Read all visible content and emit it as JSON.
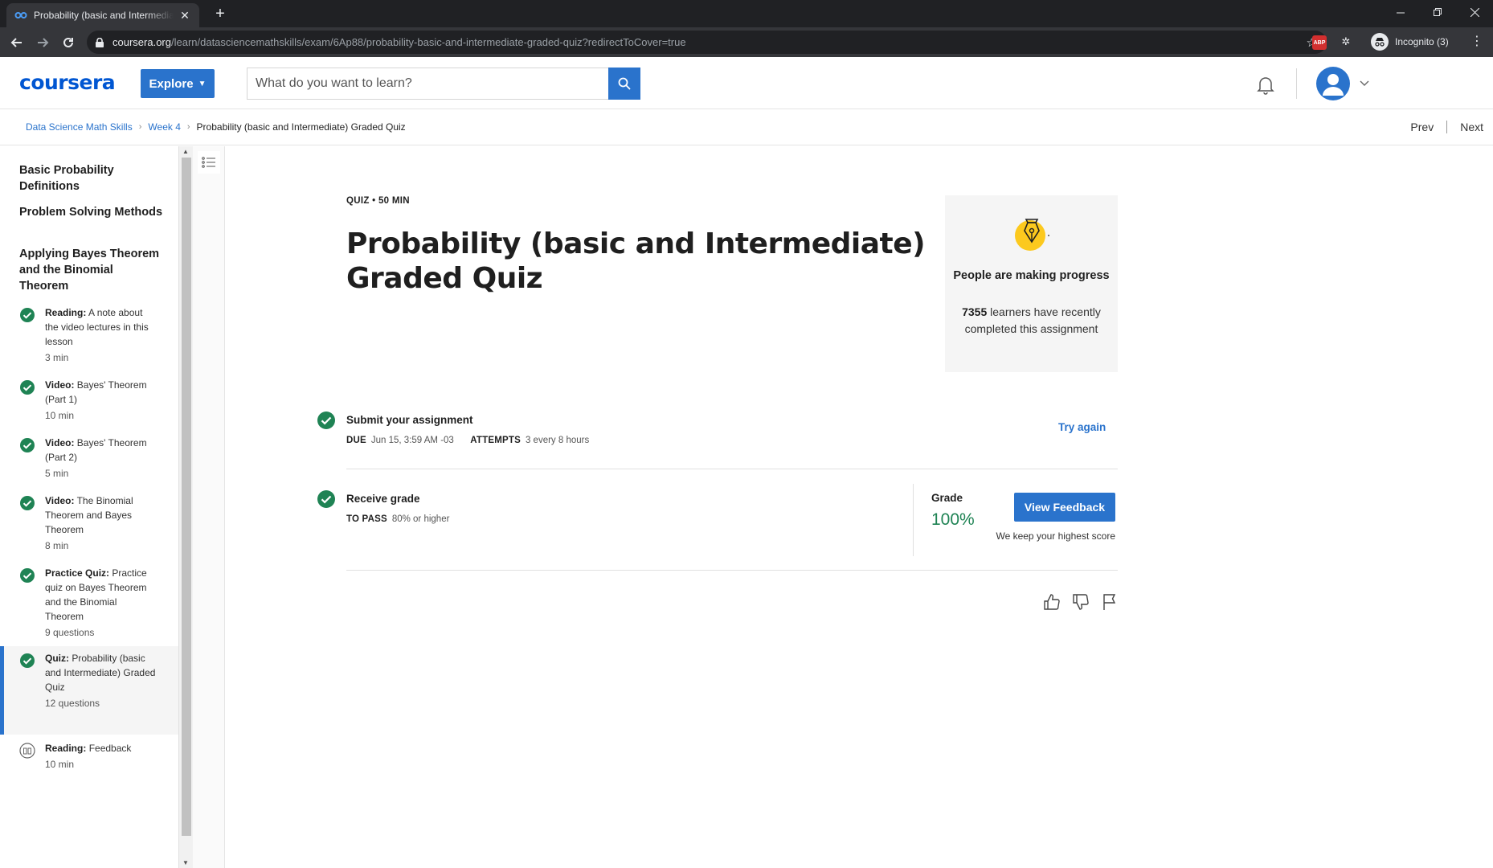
{
  "browser": {
    "tab_title": "Probability (basic and Intermediate) Graded Quiz | Coursera",
    "url_host": "coursera.org",
    "url_path": "/learn/datasciencemathskills/exam/6Ap88/probability-basic-and-intermediate-graded-quiz?redirectToCover=true",
    "incognito_label": "Incognito (3)",
    "abp_label": "ABP"
  },
  "header": {
    "logo": "coursera",
    "explore_label": "Explore",
    "search_placeholder": "What do you want to learn?"
  },
  "breadcrumb": {
    "items": [
      "Data Science Math Skills",
      "Week 4"
    ],
    "current": "Probability (basic and Intermediate) Graded Quiz",
    "prev_label": "Prev",
    "next_label": "Next"
  },
  "sidebar": {
    "sections": [
      "Basic Probability Definitions",
      "Problem Solving Methods",
      "Applying Bayes Theorem and the Binomial Theorem"
    ],
    "items": [
      {
        "type": "Reading:",
        "title": "A note about the video lectures in this lesson",
        "meta": "3 min",
        "status": "completed"
      },
      {
        "type": "Video:",
        "title": "Bayes' Theorem (Part 1)",
        "meta": "10 min",
        "status": "completed"
      },
      {
        "type": "Video:",
        "title": "Bayes' Theorem (Part 2)",
        "meta": "5 min",
        "status": "completed"
      },
      {
        "type": "Video:",
        "title": "The Binomial Theorem and Bayes Theorem",
        "meta": "8 min",
        "status": "completed"
      },
      {
        "type": "Practice Quiz:",
        "title": "Practice quiz on Bayes Theorem and the Binomial Theorem",
        "meta": "9 questions",
        "status": "completed"
      },
      {
        "type": "Quiz:",
        "title": "Probability (basic and Intermediate) Graded Quiz",
        "meta": "12 questions",
        "status": "completed",
        "active": true
      },
      {
        "type": "Reading:",
        "title": "Feedback",
        "meta": "10 min",
        "status": "not-started"
      }
    ]
  },
  "main": {
    "kicker": "QUIZ • 50 MIN",
    "title": "Probability (basic and Intermediate) Graded Quiz",
    "progress_card": {
      "title": "People are making progress",
      "count": "7355",
      "text": "learners have recently completed this assignment"
    },
    "submit": {
      "title": "Submit your assignment",
      "due_label": "DUE",
      "due_value": "Jun 15, 3:59 AM -03",
      "attempts_label": "ATTEMPTS",
      "attempts_value": "3 every 8 hours",
      "action": "Try again"
    },
    "receive": {
      "title": "Receive grade",
      "to_pass_label": "TO PASS",
      "to_pass_value": "80% or higher",
      "grade_label": "Grade",
      "grade_value": "100%",
      "action": "View Feedback",
      "note": "We keep your highest score"
    }
  },
  "colors": {
    "accent": "#2a73cc",
    "success": "#1f8354",
    "chrome_dark": "#202124"
  }
}
